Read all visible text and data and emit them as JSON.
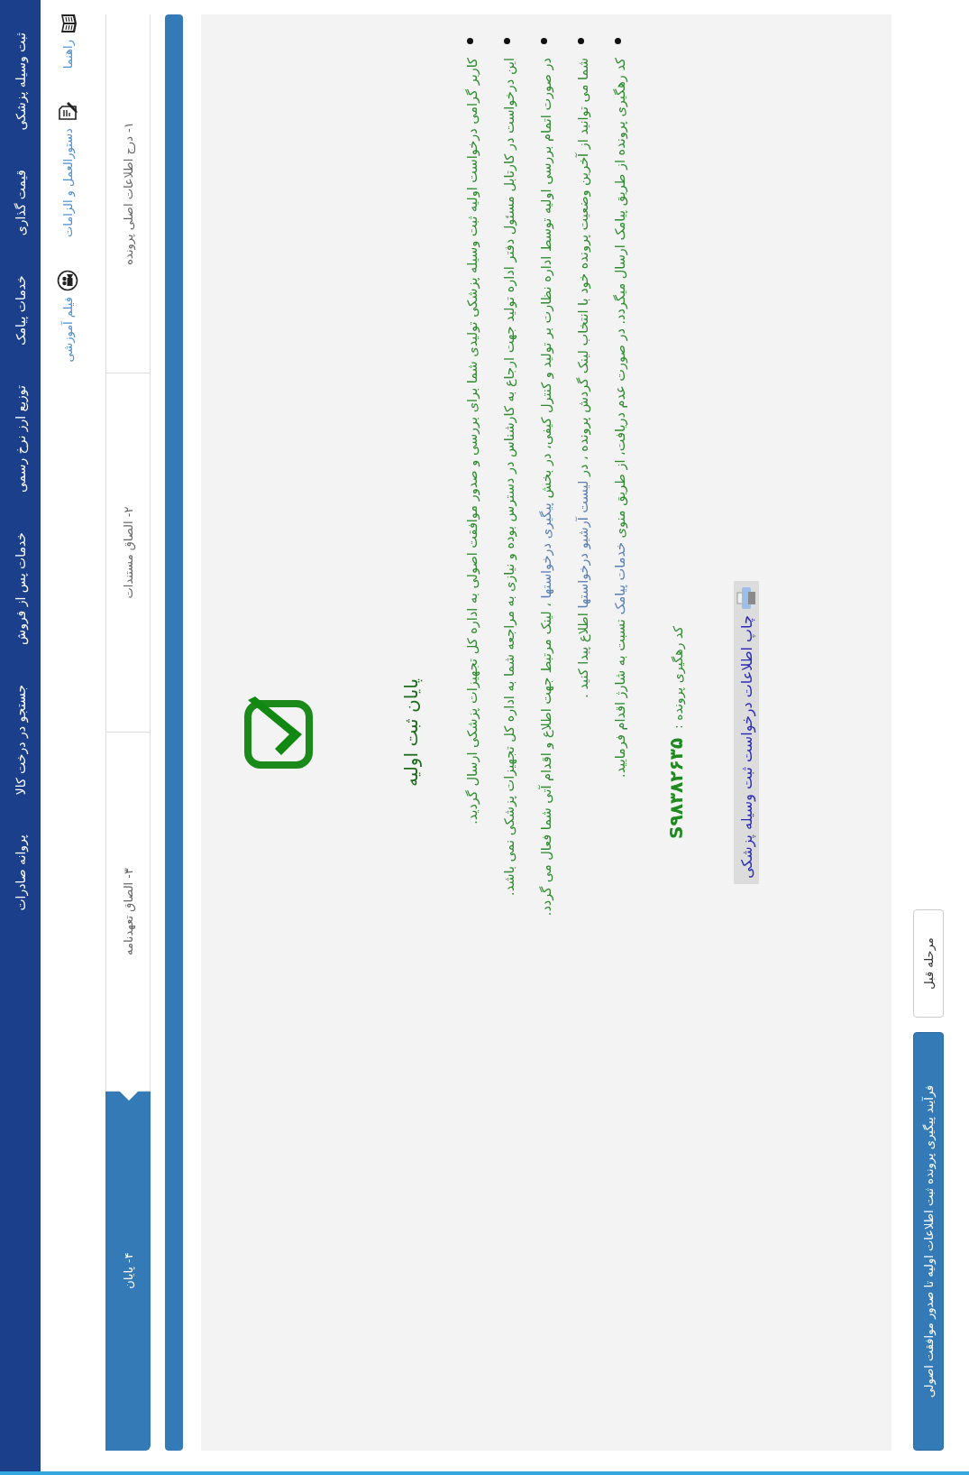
{
  "nav": {
    "items": [
      "ثبت وسیله پزشکی",
      "قیمت گذاری",
      "خدمات پیامک",
      "توزیع ارز نرخ رسمی",
      "خدمات پس از فروش",
      "جستجو در درخت کالا",
      "پروانه صادرات"
    ]
  },
  "help_links": [
    {
      "label": "راهنما",
      "kind": "book"
    },
    {
      "label": "دستورالعمل و الزامات",
      "kind": "instructions"
    },
    {
      "label": "فیلم آموزشی",
      "kind": "video"
    }
  ],
  "steps": [
    {
      "label": "۱- درج اطلاعات اصلی پرونده",
      "selected": false
    },
    {
      "label": "۲- الصاق مستندات",
      "selected": false
    },
    {
      "label": "۳- الصاق تعهدنامه",
      "selected": false
    },
    {
      "label": "۴- پایان",
      "selected": true
    }
  ],
  "progress": {
    "level": 1
  },
  "result": {
    "title": "پایان ثبت اولیه",
    "bullets": [
      {
        "parts": [
          {
            "kind": "text",
            "text": "کاربر گرامی درخواست اولیه ثبت وسیله پزشکی تولیدی شما برای بررسی و صدور موافقت اصولی به اداره کل تجهیزات پزشکی ارسال گردید."
          }
        ]
      },
      {
        "parts": [
          {
            "kind": "text",
            "text": "این درخواست در کارتابل مسئول دفتر اداره تولید جهت ارجاع به کارشناس در دسترس بوده و نیازی به مراجعه شما به اداره کل تجهیزات پزشکی نمی باشد."
          }
        ]
      },
      {
        "parts": [
          {
            "kind": "text",
            "text": "در صورت اتمام بررسی اولیه توسط اداره نظارت بر تولید و کنترل کیفی، در بخش "
          },
          {
            "kind": "link",
            "text": "پیگیری درخواستها"
          },
          {
            "kind": "text",
            "text": " ، لینک مرتبط جهت اطلاع و اقدام آتی شما فعال می گردد."
          }
        ]
      },
      {
        "parts": [
          {
            "kind": "text",
            "text": "شما می توانید از آخرین وضعیت پرونده خود با انتخاب لینک گردش پرونده ، در "
          },
          {
            "kind": "link",
            "text": "لیست آرشیو درخواستها"
          },
          {
            "kind": "text",
            "text": " اطلاع پیدا کنید ."
          }
        ]
      },
      {
        "parts": [
          {
            "kind": "text",
            "text": "کد رهگیری پرونده از طریق پیامک ارسال میگردد. در صورت عدم دریافت، از طریق منوی "
          },
          {
            "kind": "link",
            "text": "خدمات پیامک"
          },
          {
            "kind": "text",
            "text": " نسبت به شارژ اقدام فرمایید."
          }
        ]
      }
    ],
    "tracking_label": "کد رهگیری پرونده :",
    "tracking_code": "S۹۸۳۸۲۶۳۵",
    "print_button": "چاپ اطلاعات درخواست ثبت وسیله پزشکی"
  },
  "buttons": [
    {
      "label": "مرحله قبل",
      "kind": "default"
    },
    {
      "label": "فرآیند پیگیری پرونده ثبت اطلاعات اولیه تا صدور موافقت اصولی",
      "kind": "primary"
    }
  ]
}
